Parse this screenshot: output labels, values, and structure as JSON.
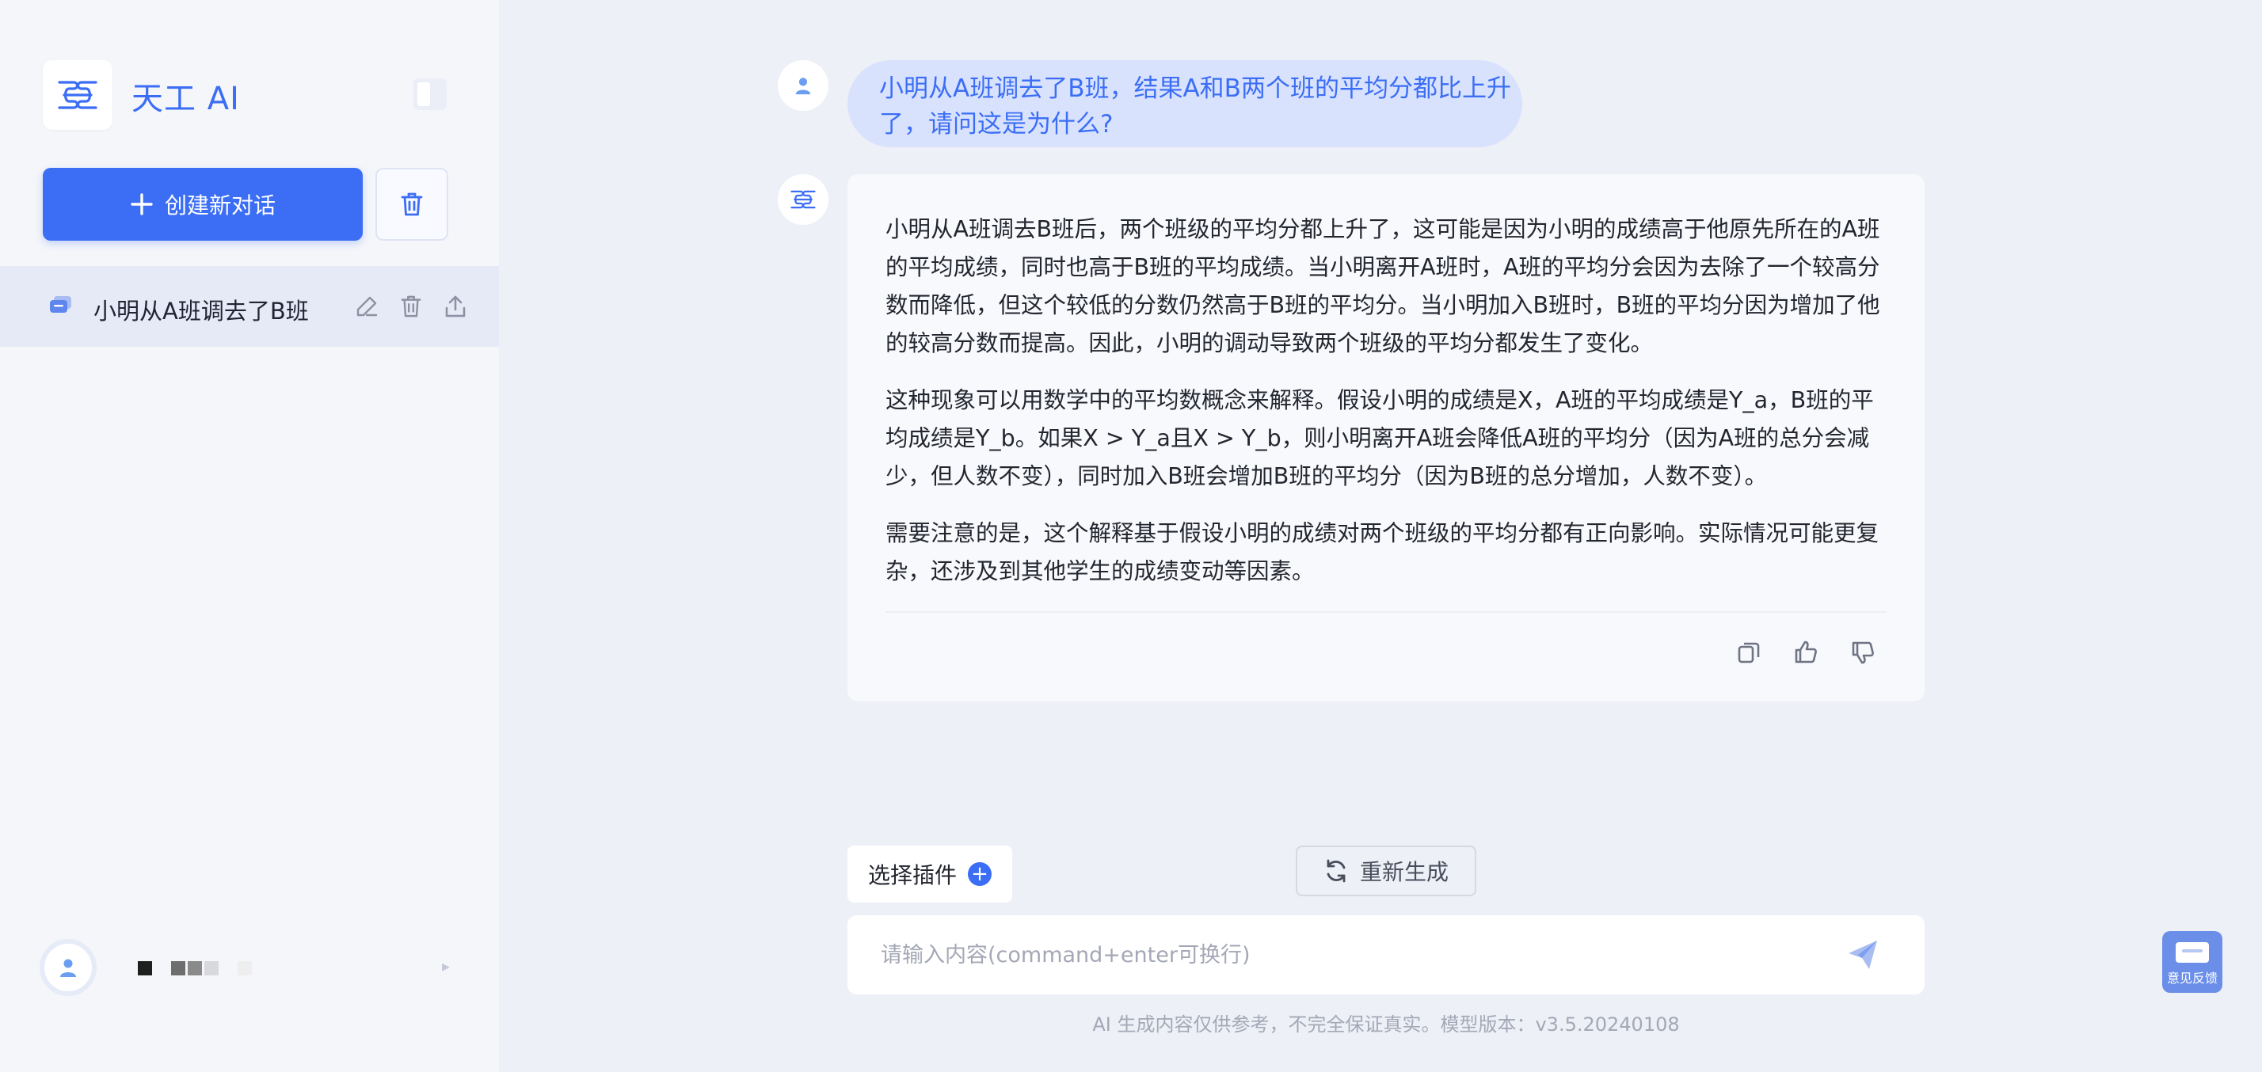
{
  "sidebar": {
    "brand": "天工 AI",
    "new_chat_label": "创建新对话",
    "conversations": [
      {
        "title": "小明从A班调去了B班"
      }
    ]
  },
  "chat": {
    "question": "小明从A班调去了B班，结果A和B两个班的平均分都比上升了，请问这是为什么?",
    "answer_paragraphs": [
      "小明从A班调去B班后，两个班级的平均分都上升了，这可能是因为小明的成绩高于他原先所在的A班的平均成绩，同时也高于B班的平均成绩。当小明离开A班时，A班的平均分会因为去除了一个较高分数而降低，但这个较低的分数仍然高于B班的平均分。当小明加入B班时，B班的平均分因为增加了他的较高分数而提高。因此，小明的调动导致两个班级的平均分都发生了变化。",
      "这种现象可以用数学中的平均数概念来解释。假设小明的成绩是X，A班的平均成绩是Y_a，B班的平均成绩是Y_b。如果X > Y_a且X > Y_b，则小明离开A班会降低A班的平均分（因为A班的总分会减少，但人数不变），同时加入B班会增加B班的平均分（因为B班的总分增加，人数不变）。",
      "需要注意的是，这个解释基于假设小明的成绩对两个班级的平均分都有正向影响。实际情况可能更复杂，还涉及到其他学生的成绩变动等因素。"
    ]
  },
  "composer": {
    "plugin_label": "选择插件",
    "regenerate_label": "重新生成",
    "input_placeholder": "请输入内容(command+enter可换行)",
    "input_value": ""
  },
  "footer": {
    "disclaimer": "AI 生成内容仅供参考，不完全保证真实。模型版本：v3.5.20240108"
  },
  "feedback": {
    "label": "意见反馈"
  },
  "colors": {
    "accent": "#3b6ef5",
    "user_bubble": "#d9e2fd",
    "sidebar_bg": "#f5f6fa",
    "main_bg": "#eef0f7"
  },
  "icons": {
    "logo": "tiangong-logo-icon",
    "collapse": "sidebar-toggle-icon",
    "new_chat": "plus-icon",
    "clear": "trash-icon",
    "conversation": "chat-bubbles-icon",
    "edit": "pencil-icon",
    "delete": "trash-icon",
    "share": "share-icon",
    "copy": "copy-icon",
    "like": "thumbs-up-icon",
    "dislike": "thumbs-down-icon",
    "regenerate": "refresh-icon",
    "send": "send-icon",
    "avatar": "user-avatar-icon"
  }
}
